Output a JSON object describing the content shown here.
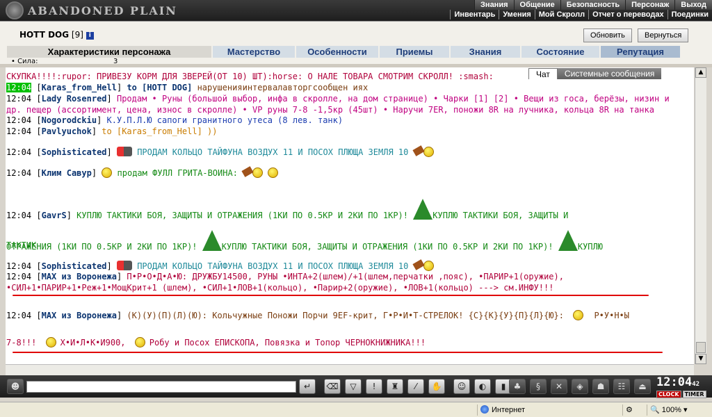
{
  "app": {
    "logo_text": "ABANDONED PLAIN"
  },
  "topmenu": {
    "row1": [
      "Знания",
      "Общение",
      "Безопасность",
      "Персонаж",
      "Выход"
    ],
    "row2": [
      "Инвентарь",
      "Умения",
      "Мой Скролл",
      "Отчет о переводах",
      "Поединки"
    ]
  },
  "player": {
    "name": "HOTT DOG",
    "level": "[9]",
    "info_icon": "i"
  },
  "header_buttons": {
    "refresh": "Обновить",
    "back": "Вернуться"
  },
  "tabs": [
    {
      "label": "Характеристики персонажа"
    },
    {
      "label": "Мастерство"
    },
    {
      "label": "Особенности"
    },
    {
      "label": "Приемы"
    },
    {
      "label": "Знания"
    },
    {
      "label": "Состояние"
    },
    {
      "label": "Репутация"
    }
  ],
  "char_row": {
    "label": "• Сила:",
    "value": "3"
  },
  "chat_tabs": {
    "chat": "Чат",
    "system": "Системные сообщения"
  },
  "chat": {
    "top_partial": "СКУПКА!!!!:rupor: ПРИВЕЗУ КОРМ ДЛЯ ЗВЕРЕЙ(ОТ 10) ШТ):horse: О НАЛЕ ТОВАРА СМОТРИМ СКРОЛЛ! :smash:",
    "messages": [
      {
        "time": "12:04",
        "nick": "Karas_from_Hell",
        "to": "to [HOTT DOG]",
        "text": " нарушенияинтервалавторгсообщен иях"
      },
      {
        "time": "12:04",
        "nick": "Lady Rosenred",
        "text": " Продам • Руны (большой выбор, инфа в скролле, на дом странице) • Чарки [1] [2] • Вещи из госа, берёзы, низин и",
        "text2": "др. пещер (ассортимент, цена, износ в скролле) • VP руны 7-8 -1,5кр (45шт) • Наручи 7ER, поножи 8R на лучника, кольца 8R на танка"
      },
      {
        "time": "12:04",
        "nick": "Nogorodckiu",
        "text": " К.У.П.Л.Ю сапоги гранитного утеса (8 лев. танк)"
      },
      {
        "time": "12:04",
        "nick": "Pavlyuchok",
        "text": " to [Karas_from_Hell] ))"
      },
      {
        "time": "12:04",
        "nick": "Sophisticated",
        "text": " ПРОДАМ КОЛЬЦО ТАЙФУНА ВОЗДУХ 11 И ПОСОХ ПЛЮЩА ЗЕМЛЯ 10"
      },
      {
        "time": "12:04",
        "nick": "Клим Савур",
        "text": " продам ФУЛЛ ГРИТА-ВОИНА:"
      },
      {
        "time": "12:04",
        "nick": "GavrS",
        "text": " КУПЛЮ ТАКТИКИ БОЯ, ЗАЩИТЫ И ОТРАЖЕНИЯ (1КИ ПО 0.5КР И 2КИ ПО 1КР)!",
        "text_tail": "КУПЛЮ ТАКТИКИ БОЯ, ЗАЩИТЫ И",
        "text2": "ОТРАЖЕНИЯ (1КИ ПО 0.5КР И 2КИ ПО 1КР)!",
        "text2b": "КУПЛЮ ТАКТИКИ БОЯ, ЗАЩИТЫ И ОТРАЖЕНИЯ (1КИ ПО 0.5КР И 2КИ ПО 1КР)!",
        "text2c": "КУПЛЮ",
        "text3": "ТАКТИК"
      },
      {
        "time": "12:04",
        "nick": "Sophisticated",
        "text": " ПРОДАМ КОЛЬЦО ТАЙФУНА ВОЗДУХ 11 И ПОСОХ ПЛЮЩА ЗЕМЛЯ 10"
      },
      {
        "time": "12:04",
        "nick": "MAX из Воронежа",
        "text": " П•Р•О•Д•А•Ю: ДРУЖБУ14500, РУНЫ •ИНТА+2(шлем)/+1(шлем,перчатки ,пояс), •ПАРИР+1(оружие),",
        "text2": "•СИЛ+1•ПАРИР+1•Реж+1•МощКрит+1 (шлем), •СИЛ+1•ЛОВ+1(кольцо), •Парир+2(оружие), •ЛОВ+1(кольцо) ---> см.ИНФУ!!!"
      },
      {
        "time": "12:04",
        "nick": "MAX из Воронежа",
        "text": " (К)(У)(П)(Л)(Ю): Кольчужные Поножи Порчи 9EF-крит, Г•Р•И•Т-СТРЕЛОК! {С}{К}{У}{П}{Л}{Ю}:",
        "text_tail": "Р•У•Н•Ы",
        "text2": "7-8!!!",
        "text2b": "Х•И•Л•К•И900,",
        "text2c": "Робу и Посох ЕПИСКОПА, Повязка и Топор ЧЕРНОКНИЖНИКА!!!"
      }
    ]
  },
  "clock": {
    "time": "12:04",
    "seconds": "42",
    "label1": "CLOCK",
    "label2": "TIMER"
  },
  "statusbar": {
    "zone": "Интернет",
    "zoom": "100%"
  },
  "colors": {
    "nick": "#0b3470",
    "highlight": "#00c000",
    "underline": "#e00000"
  }
}
